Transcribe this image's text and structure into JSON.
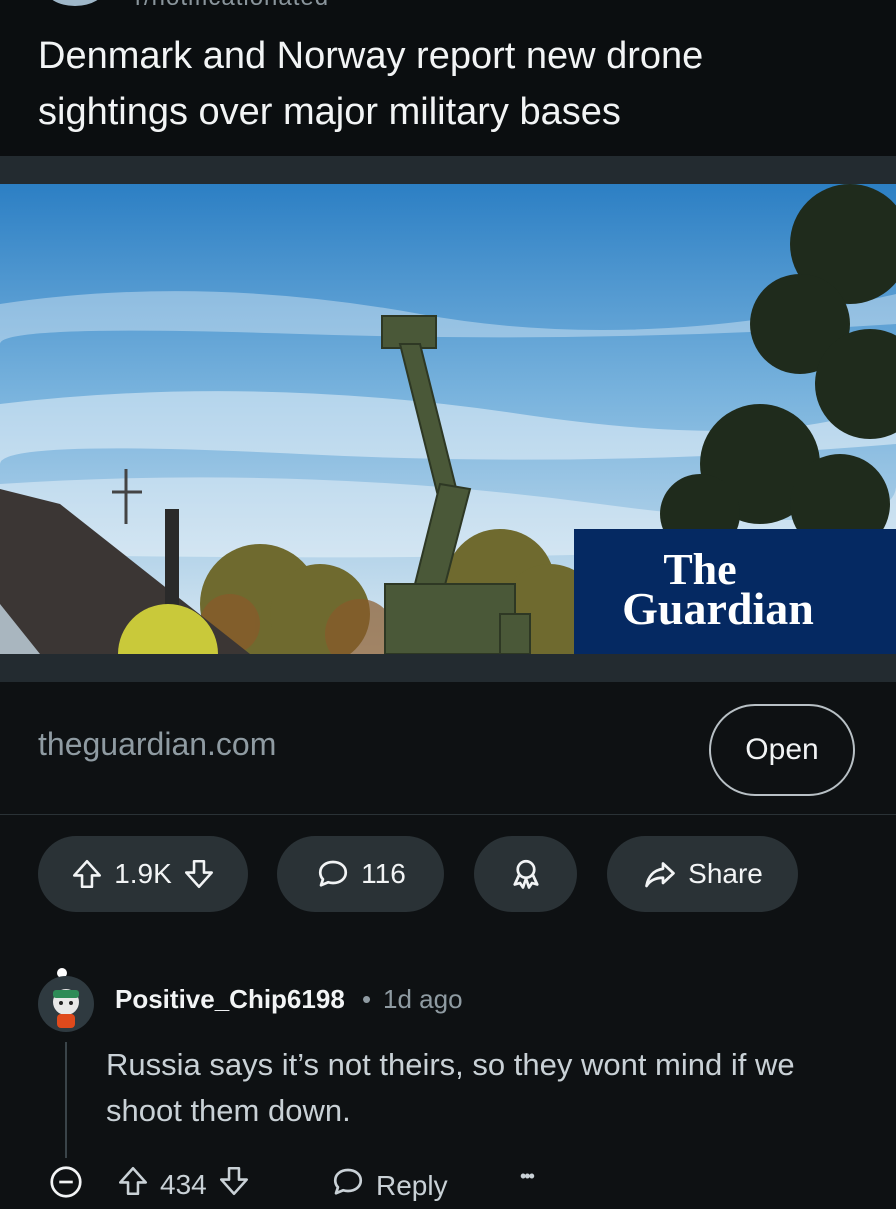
{
  "post": {
    "cut_header_text": "r/notificationated",
    "title": "Denmark and Norway report new drone sightings over major military bases"
  },
  "hero": {
    "publisher_logo_line1": "The",
    "publisher_logo_line2": "Guardian"
  },
  "link": {
    "domain": "theguardian.com",
    "open_label": "Open"
  },
  "actions": {
    "score": "1.9K",
    "comments": "116",
    "share_label": "Share"
  },
  "comment": {
    "username": "Positive_Chip6198",
    "separator": "•",
    "age": "1d ago",
    "body": "Russia says it’s not theirs, so they wont mind if we shoot them down.",
    "score": "434",
    "reply_label": "Reply",
    "more_label": "•••"
  },
  "colors": {
    "background": "#0e1113",
    "pill": "#2a3236",
    "guardian_blue": "#052962"
  }
}
